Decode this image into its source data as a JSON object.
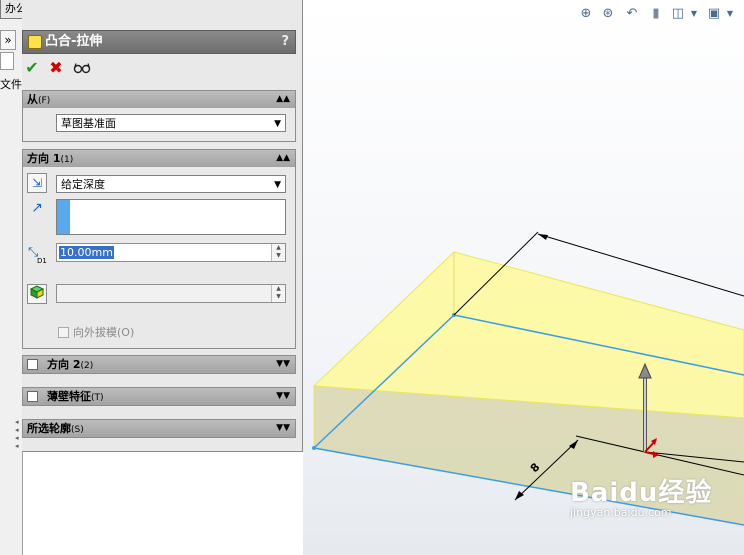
{
  "left_strip": {
    "tab_label": "办公室产品",
    "expand_glyph": "»",
    "file_char": "文件"
  },
  "property_manager": {
    "title": "凸合-拉伸",
    "help_glyph": "?",
    "actions": {
      "ok_glyph": "✔",
      "cancel_glyph": "✖",
      "preview_glyph": "👓"
    },
    "from_group": {
      "label": "从",
      "shortcut": "(F)",
      "value": "草图基准面"
    },
    "direction1_group": {
      "label": "方向 1",
      "shortcut": "(1)",
      "end_condition": "给定深度",
      "depth": "10.00mm",
      "draft_label": "向外拔模(O)",
      "dim_label": "D1"
    },
    "direction2_group": {
      "label": "方向 2",
      "shortcut": "(2)"
    },
    "thin_group": {
      "label": "薄壁特征",
      "shortcut": "(T)"
    },
    "contours_group": {
      "label": "所选轮廓",
      "shortcut": "(S)"
    }
  },
  "viewport": {
    "dimension_label": "8",
    "watermark_main": "Baidu经验",
    "watermark_sub": "jingyan.baidu.com"
  },
  "colors": {
    "accent_blue": "#3470cc",
    "edge_blue": "#3a9ce6",
    "preview_yellow": "#fffa8c",
    "ok_green": "#1c9a1c",
    "cancel_red": "#d40000"
  }
}
